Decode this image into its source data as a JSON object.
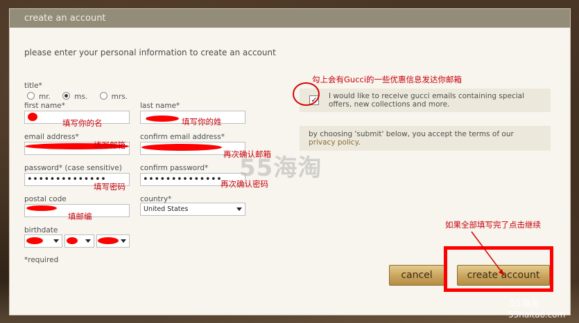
{
  "modal": {
    "header": "create an account",
    "intro": "please enter your personal information to create an account"
  },
  "form": {
    "title_label": "title*",
    "title_options": [
      "mr.",
      "ms.",
      "mrs."
    ],
    "first_name_label": "first name*",
    "last_name_label": "last name*",
    "email_label": "email address*",
    "confirm_email_label": "confirm email address*",
    "password_label": "password* (case sensitive)",
    "confirm_password_label": "confirm password*",
    "password_value": "••••••••••••••",
    "confirm_password_value": "••••••••••••••",
    "postal_label": "postal code",
    "country_label": "country*",
    "country_value": "United States",
    "birthdate_label": "birthdate",
    "required_note": "*required"
  },
  "optin": {
    "text": "I would like to receive gucci emails containing special offers, new collections and more."
  },
  "terms": {
    "text": "by choosing 'submit' below, you accept the terms of our",
    "link": "privacy policy",
    "suffix": "."
  },
  "buttons": {
    "cancel": "cancel",
    "create": "create account"
  },
  "annotations": {
    "first_name": "填写你的名",
    "last_name": "填写你的姓",
    "email": "填写邮箱",
    "confirm_email": "再次确认邮箱",
    "password": "填写密码",
    "confirm_password": "再次确认密码",
    "postal": "填邮编",
    "optin": "勾上会有Gucci的一些优惠信息发达你邮箱",
    "continue": "如果全部填写完了点击继续"
  },
  "watermark": {
    "center": "55海淘",
    "corner": "55海淘",
    "site": "55haitao.com"
  },
  "colors": {
    "annotation_red": "#c8000a",
    "header_bg": "#928c79",
    "button_gold": "#c9a45d"
  }
}
